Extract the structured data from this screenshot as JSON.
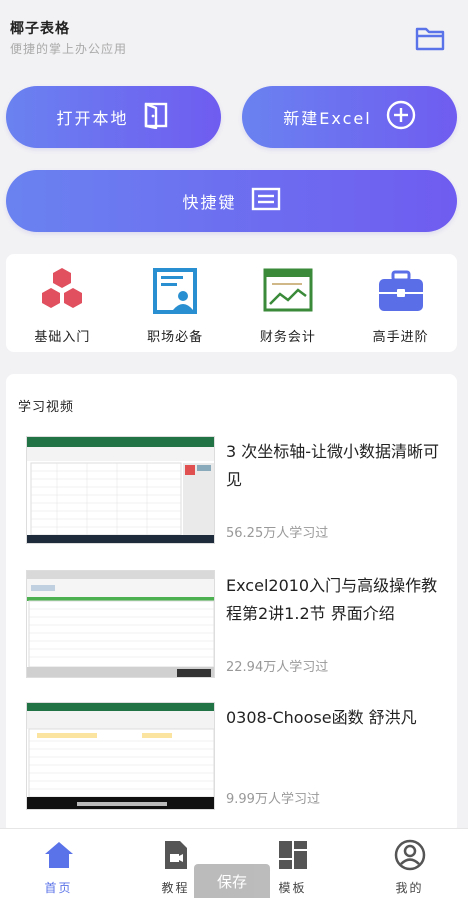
{
  "header": {
    "title": "椰子表格",
    "subtitle": "便捷的掌上办公应用",
    "folder_icon": "folder-icon"
  },
  "actions": {
    "open_local": "打开本地",
    "new_excel": "新建Excel",
    "quick_build": "快捷键"
  },
  "categories": [
    {
      "label": "基础入门",
      "icon": "hexagon-cluster-icon",
      "color": "#e0505e"
    },
    {
      "label": "职场必备",
      "icon": "id-card-icon",
      "color": "#2a8fd0"
    },
    {
      "label": "财务会计",
      "icon": "chart-frame-icon",
      "color": "#3a8a3a"
    },
    {
      "label": "高手进阶",
      "icon": "toolbox-icon",
      "color": "#5a6ee8"
    }
  ],
  "videos": {
    "section_title": "学习视频",
    "items": [
      {
        "title": "3 次坐标轴-让微小数据清晰可见",
        "views": "56.25万人学习过"
      },
      {
        "title": "Excel2010入门与高级操作教程第2讲1.2节 界面介绍",
        "views": "22.94万人学习过"
      },
      {
        "title": "0308-Choose函数 舒洪凡",
        "views": "9.99万人学习过"
      }
    ]
  },
  "tabs": [
    {
      "label": "首页",
      "icon": "home-icon"
    },
    {
      "label": "教程",
      "icon": "video-icon"
    },
    {
      "label": "模板",
      "icon": "template-grid-icon"
    },
    {
      "label": "我的",
      "icon": "user-circle-icon"
    }
  ],
  "toast": {
    "label": "保存"
  },
  "colors": {
    "accent": "#5b73e8",
    "gradient_start": "#6a82f0",
    "gradient_end": "#6f5cf0"
  }
}
